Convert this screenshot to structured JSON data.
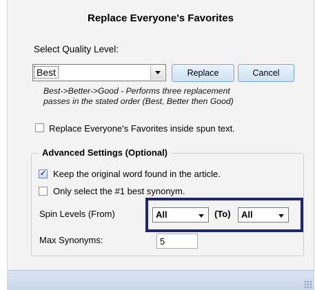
{
  "dialog": {
    "title": "Replace Everyone's Favorites",
    "quality_label": "Select Quality Level:",
    "quality_selected": "Best",
    "replace_label": "Replace",
    "cancel_label": "Cancel",
    "description_line1": "Best->Better->Good - Performs three replacement",
    "description_line2": "passes in the stated order (Best, Better then Good)",
    "spun_text_option": {
      "label": "Replace Everyone's Favorites inside spun text.",
      "checked": false
    }
  },
  "advanced": {
    "title": "Advanced Settings (Optional)",
    "keep_original": {
      "label": "Keep the original word found in the article.",
      "checked": true
    },
    "best_synonym": {
      "label": "Only select the #1 best synonym.",
      "checked": false
    },
    "spin_levels_label": "Spin Levels (From)",
    "spin_from_value": "All",
    "to_label": "(To)",
    "spin_to_value": "All",
    "max_synonyms_label": "Max Synonyms:",
    "max_synonyms_value": "5"
  },
  "icons": {
    "dropdown": "chevron-down-icon",
    "checkmark": "checkmark-icon",
    "resize_grip": "resize-grip-icon"
  },
  "colors": {
    "highlight_border": "#1f2670",
    "button_fill": "#cfe2f5",
    "status_bar": "#c8d7ea"
  }
}
